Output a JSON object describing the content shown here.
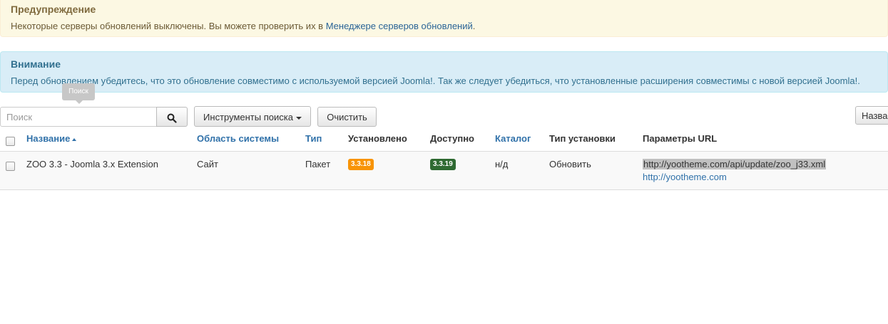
{
  "warning": {
    "title": "Предупреждение",
    "text": "Некоторые серверы обновлений выключены. Вы можете проверить их в ",
    "link": "Менеджере серверов обновлений",
    "suffix": "."
  },
  "info": {
    "title": "Внимание",
    "text": "Перед обновлением убедитесь, что это обновление совместимо с используемой версией Joomla!. Так же следует убедиться, что установленные расширения совместимы с новой версией Joomla!."
  },
  "toolbar": {
    "search_tooltip": "Поиск",
    "search_placeholder": "Поиск",
    "search_tools_label": "Инструменты поиска",
    "clear_label": "Очистить",
    "sort_label": "Назва"
  },
  "table": {
    "headers": {
      "name": "Название",
      "area": "Область системы",
      "type": "Тип",
      "installed": "Установлено",
      "available": "Доступно",
      "folder": "Каталог",
      "install_type": "Тип установки",
      "url": "Параметры URL"
    },
    "rows": [
      {
        "name": "ZOO 3.3 - Joomla 3.x Extension",
        "area": "Сайт",
        "type": "Пакет",
        "installed": "3.3.18",
        "available": "3.3.19",
        "folder": "н/д",
        "install_type": "Обновить",
        "url": "http://yootheme.com/api/update/zoo_j33.xml",
        "info_url": "http://yootheme.com"
      }
    ]
  },
  "colors": {
    "installed_badge": "#f89406",
    "available_badge": "#2f6a32",
    "link": "#3071a9"
  }
}
